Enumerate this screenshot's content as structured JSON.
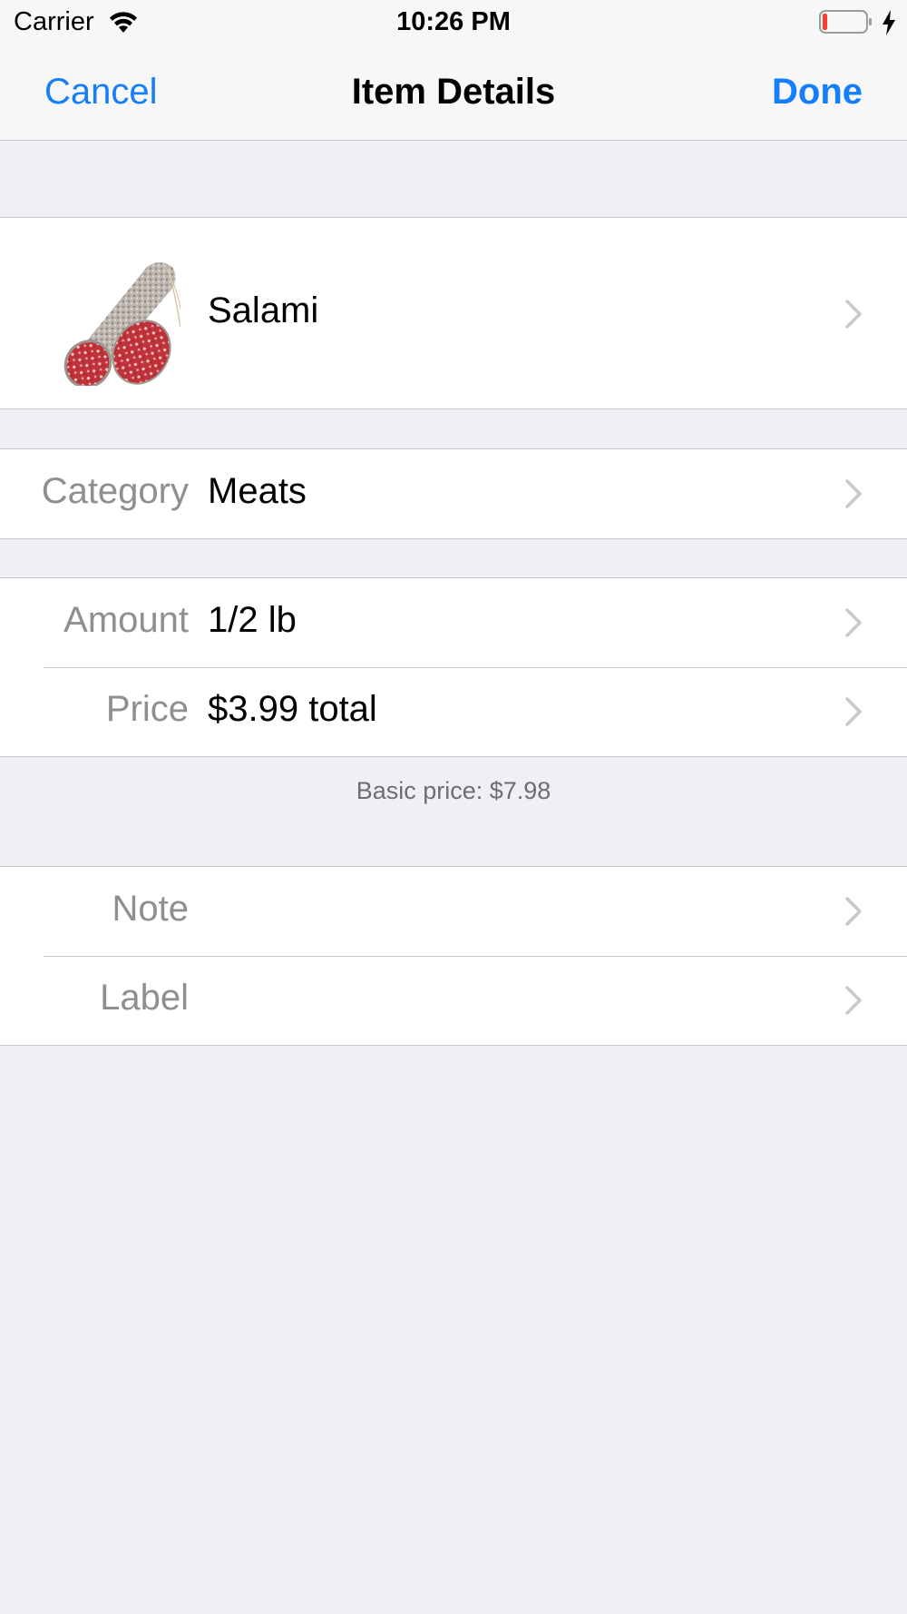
{
  "status_bar": {
    "carrier": "Carrier",
    "time": "10:26 PM",
    "wifi_icon": "wifi-icon",
    "battery_icon": "battery-low-icon",
    "charging_icon": "charging-bolt-icon"
  },
  "nav": {
    "cancel": "Cancel",
    "title": "Item Details",
    "done": "Done"
  },
  "item": {
    "name": "Salami",
    "image_icon": "salami-photo"
  },
  "category": {
    "label": "Category",
    "value": "Meats"
  },
  "amount": {
    "label": "Amount",
    "value": "1/2 lb"
  },
  "price": {
    "label": "Price",
    "value": "$3.99 total"
  },
  "basic_price_note": "Basic price: $7.98",
  "note": {
    "label": "Note",
    "value": ""
  },
  "label": {
    "label": "Label",
    "value": ""
  },
  "colors": {
    "tint": "#147efb",
    "background": "#efeff4",
    "secondary_text": "#8e8e93",
    "battery_low": "#ff3b30"
  }
}
